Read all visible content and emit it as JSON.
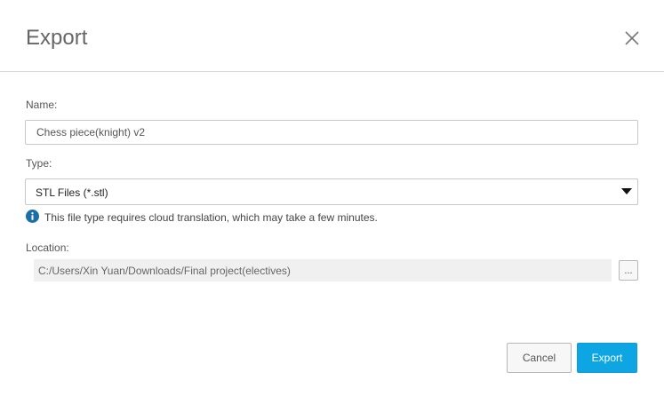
{
  "dialog": {
    "title": "Export",
    "close_icon": "close-icon"
  },
  "name_field": {
    "label": "Name:",
    "value": "Chess piece(knight) v2"
  },
  "type_field": {
    "label": "Type:",
    "selected": "STL Files (*.stl)",
    "arrow_icon": "dropdown-arrow-icon"
  },
  "info": {
    "icon": "info-icon",
    "text": "This file type requires cloud translation, which may take a few minutes."
  },
  "location_field": {
    "label": "Location:",
    "value": "C:/Users/Xin Yuan/Downloads/Final project(electives)",
    "browse_label": "..."
  },
  "buttons": {
    "cancel": "Cancel",
    "export": "Export"
  },
  "colors": {
    "accent": "#0ea5e3",
    "info_icon": "#1a6fa8"
  }
}
